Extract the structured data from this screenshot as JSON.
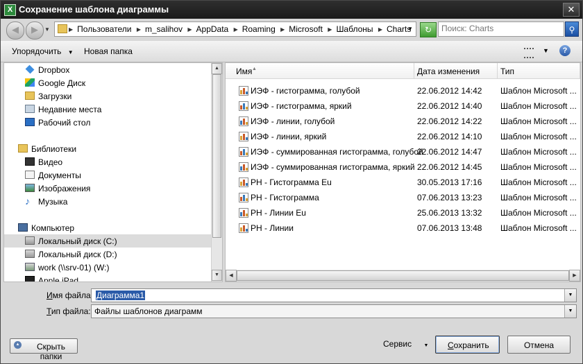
{
  "window": {
    "title": "Сохранение шаблона диаграммы",
    "app_icon": "X",
    "close_glyph": "✕"
  },
  "address": {
    "breadcrumb": [
      "Пользователи",
      "m_salihov",
      "AppData",
      "Roaming",
      "Microsoft",
      "Шаблоны",
      "Charts"
    ],
    "search_placeholder": "Поиск: Charts"
  },
  "toolbar": {
    "organize_label": "Упорядочить",
    "new_folder_label": "Новая папка"
  },
  "nav": {
    "items": [
      {
        "label": "Dropbox",
        "icon": "dropbox-icon"
      },
      {
        "label": "Google Диск",
        "icon": "google-drive-icon"
      },
      {
        "label": "Загрузки",
        "icon": "downloads-icon"
      },
      {
        "label": "Недавние места",
        "icon": "recent-places-icon"
      },
      {
        "label": "Рабочий стол",
        "icon": "desktop-icon"
      },
      {
        "label": "Библиотеки",
        "icon": "libraries-icon"
      },
      {
        "label": "Видео",
        "icon": "video-icon"
      },
      {
        "label": "Документы",
        "icon": "documents-icon"
      },
      {
        "label": "Изображения",
        "icon": "pictures-icon"
      },
      {
        "label": "Музыка",
        "icon": "music-icon"
      },
      {
        "label": "Компьютер",
        "icon": "computer-icon"
      },
      {
        "label": "Локальный диск (C:)",
        "icon": "drive-icon",
        "selected": true
      },
      {
        "label": "Локальный диск (D:)",
        "icon": "drive-icon"
      },
      {
        "label": "work (\\\\srv-01) (W:)",
        "icon": "network-drive-icon"
      },
      {
        "label": "Apple iPad",
        "icon": "ipad-icon"
      }
    ]
  },
  "files": {
    "columns": {
      "name": "Имя",
      "date": "Дата изменения",
      "type": "Тип"
    },
    "rows": [
      {
        "name": "ИЭФ - гистограмма, голубой",
        "date": "22.06.2012 14:42",
        "type": "Шаблон Microsoft ..."
      },
      {
        "name": "ИЭФ - гистограмма, яркий",
        "date": "22.06.2012 14:40",
        "type": "Шаблон Microsoft ..."
      },
      {
        "name": "ИЭФ - линии, голубой",
        "date": "22.06.2012 14:22",
        "type": "Шаблон Microsoft ..."
      },
      {
        "name": "ИЭФ - линии, яркий",
        "date": "22.06.2012 14:10",
        "type": "Шаблон Microsoft ..."
      },
      {
        "name": "ИЭФ - суммированная гистограмма, голубой",
        "date": "22.06.2012 14:47",
        "type": "Шаблон Microsoft ..."
      },
      {
        "name": "ИЭФ - суммированная гистограмма, яркий",
        "date": "22.06.2012 14:45",
        "type": "Шаблон Microsoft ..."
      },
      {
        "name": "РН - Гистограмма Eu",
        "date": "30.05.2013 17:16",
        "type": "Шаблон Microsoft ..."
      },
      {
        "name": "РН - Гистограмма",
        "date": "07.06.2013 13:23",
        "type": "Шаблон Microsoft ..."
      },
      {
        "name": "РН - Линии Eu",
        "date": "25.06.2013 13:32",
        "type": "Шаблон Microsoft ..."
      },
      {
        "name": "РН - Линии",
        "date": "07.06.2013 13:48",
        "type": "Шаблон Microsoft ..."
      }
    ]
  },
  "form": {
    "filename_label_ul": "И",
    "filename_label_rest": "мя файла:",
    "filename_value": "Диаграмма1",
    "filetype_label_ul": "Т",
    "filetype_label_rest": "ип файла:",
    "filetype_value": "Файлы шаблонов диаграмм"
  },
  "footer": {
    "hide_folders_label": "Скрыть папки",
    "service_label": "Сервис",
    "save_label_ul": "С",
    "save_label_rest": "охранить",
    "cancel_label": "Отмена"
  },
  "colors": {
    "titlebar": "#1f1f1f",
    "selection": "#2a5aa8",
    "nav_selected": "#dcdcdc"
  }
}
